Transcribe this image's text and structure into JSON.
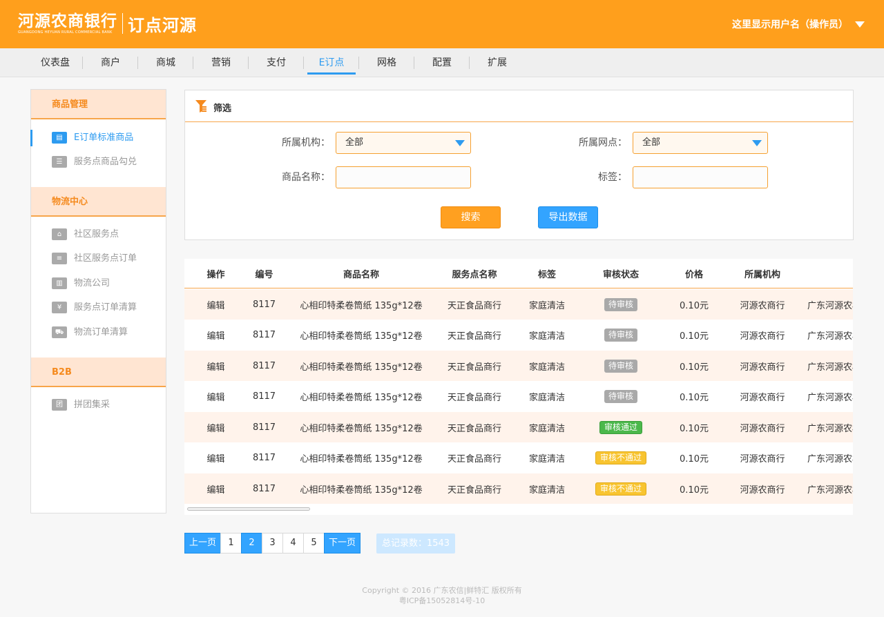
{
  "header": {
    "logo_bank": "河源农商银行",
    "logo_bank_en": "GUANGDONG HEYUAN RURAL COMMERCIAL BANK",
    "logo_app": "订点河源",
    "user_label": "这里显示用户名（操作员）",
    "bg_color": "#ff9f1c"
  },
  "nav": {
    "items": [
      {
        "label": "仪表盘"
      },
      {
        "label": "商户"
      },
      {
        "label": "商城"
      },
      {
        "label": "营销"
      },
      {
        "label": "支付"
      },
      {
        "label": "E订点"
      },
      {
        "label": "网格"
      },
      {
        "label": "配置"
      },
      {
        "label": "扩展"
      }
    ],
    "active_index": 5
  },
  "sidebar": {
    "sections": [
      {
        "title": "商品管理",
        "items": [
          {
            "label": "E订单标准商品",
            "icon": "product-icon",
            "active": true
          },
          {
            "label": "服务点商品勾兑",
            "icon": "list-icon",
            "active": false
          }
        ]
      },
      {
        "title": "物流中心",
        "items": [
          {
            "label": "社区服务点",
            "icon": "store-icon"
          },
          {
            "label": "社区服务点订单",
            "icon": "order-icon"
          },
          {
            "label": "物流公司",
            "icon": "building-icon"
          },
          {
            "label": "服务点订单清算",
            "icon": "settle-icon"
          },
          {
            "label": "物流订单清算",
            "icon": "truck-icon"
          }
        ]
      },
      {
        "title": "B2B",
        "items": [
          {
            "label": "拼团集采",
            "icon": "group-icon"
          }
        ]
      }
    ]
  },
  "filter": {
    "title": "筛选",
    "org_label": "所属机构：",
    "org_value": "全部",
    "outlet_label": "所属网点：",
    "outlet_value": "全部",
    "name_label": "商品名称：",
    "name_value": "",
    "tag_label": "标签：",
    "tag_value": "",
    "search_button": "搜索",
    "export_button": "导出数据"
  },
  "table": {
    "columns": [
      "操作",
      "编号",
      "商品名称",
      "服务点名称",
      "标签",
      "审核状态",
      "价格",
      "所属机构",
      ""
    ],
    "rows": [
      {
        "action": "编辑",
        "id": "8117",
        "name": "心相印特柔卷筒纸 135g*12卷",
        "outlet": "天正食品商行",
        "tag": "家庭清洁",
        "status": "待审核",
        "status_type": "pending",
        "price": "0.10元",
        "org": "河源农商行",
        "extra": "广东河源农村"
      },
      {
        "action": "编辑",
        "id": "8117",
        "name": "心相印特柔卷筒纸 135g*12卷",
        "outlet": "天正食品商行",
        "tag": "家庭清洁",
        "status": "待审核",
        "status_type": "pending",
        "price": "0.10元",
        "org": "河源农商行",
        "extra": "广东河源农村"
      },
      {
        "action": "编辑",
        "id": "8117",
        "name": "心相印特柔卷筒纸 135g*12卷",
        "outlet": "天正食品商行",
        "tag": "家庭清洁",
        "status": "待审核",
        "status_type": "pending",
        "price": "0.10元",
        "org": "河源农商行",
        "extra": "广东河源农村"
      },
      {
        "action": "编辑",
        "id": "8117",
        "name": "心相印特柔卷筒纸 135g*12卷",
        "outlet": "天正食品商行",
        "tag": "家庭清洁",
        "status": "待审核",
        "status_type": "pending",
        "price": "0.10元",
        "org": "河源农商行",
        "extra": "广东河源农村"
      },
      {
        "action": "编辑",
        "id": "8117",
        "name": "心相印特柔卷筒纸 135g*12卷",
        "outlet": "天正食品商行",
        "tag": "家庭清洁",
        "status": "审核通过",
        "status_type": "pass",
        "price": "0.10元",
        "org": "河源农商行",
        "extra": "广东河源农村"
      },
      {
        "action": "编辑",
        "id": "8117",
        "name": "心相印特柔卷筒纸 135g*12卷",
        "outlet": "天正食品商行",
        "tag": "家庭清洁",
        "status": "审核不通过",
        "status_type": "fail",
        "price": "0.10元",
        "org": "河源农商行",
        "extra": "广东河源农村"
      },
      {
        "action": "编辑",
        "id": "8117",
        "name": "心相印特柔卷筒纸 135g*12卷",
        "outlet": "天正食品商行",
        "tag": "家庭清洁",
        "status": "审核不通过",
        "status_type": "fail",
        "price": "0.10元",
        "org": "河源农商行",
        "extra": "广东河源农村"
      }
    ]
  },
  "pagination": {
    "prev": "上一页",
    "next": "下一页",
    "pages": [
      "1",
      "2",
      "3",
      "4",
      "5"
    ],
    "current": "2",
    "total_label": "总记录数：1543"
  },
  "footer": {
    "line1": "Copyright © 2016 广东农信|鲜特汇 版权所有",
    "line2": "粤ICP备15052814号-10"
  }
}
